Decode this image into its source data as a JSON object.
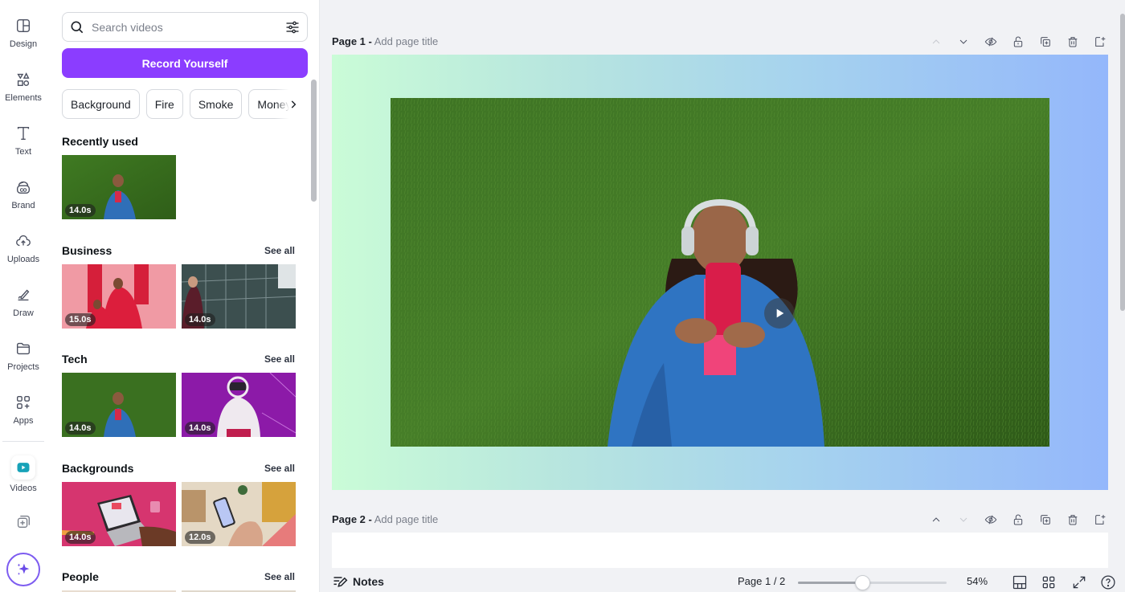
{
  "rail": {
    "items": [
      {
        "label": "Design",
        "icon": "layout-icon"
      },
      {
        "label": "Elements",
        "icon": "shapes-icon"
      },
      {
        "label": "Text",
        "icon": "text-icon"
      },
      {
        "label": "Brand",
        "icon": "brand-icon"
      },
      {
        "label": "Uploads",
        "icon": "cloud-upload-icon"
      },
      {
        "label": "Draw",
        "icon": "pen-icon"
      },
      {
        "label": "Projects",
        "icon": "folder-icon"
      },
      {
        "label": "Apps",
        "icon": "apps-icon"
      },
      {
        "label": "Videos",
        "icon": "video-icon"
      }
    ],
    "accent": "#17a2b8"
  },
  "panel": {
    "search_placeholder": "Search videos",
    "record_label": "Record Yourself",
    "record_color": "#8b3dff",
    "chips": [
      "Background",
      "Fire",
      "Smoke",
      "Money"
    ],
    "see_all": "See all",
    "sections": [
      {
        "title": "Recently used",
        "items": [
          {
            "duration": "14.0s",
            "subject": "woman on grass"
          }
        ]
      },
      {
        "title": "Business",
        "items": [
          {
            "duration": "15.0s",
            "subject": "women in red"
          },
          {
            "duration": "14.0s",
            "subject": "woman on phone by building"
          }
        ]
      },
      {
        "title": "Tech",
        "items": [
          {
            "duration": "14.0s",
            "subject": "woman on grass"
          },
          {
            "duration": "14.0s",
            "subject": "VR headset purple"
          }
        ]
      },
      {
        "title": "Backgrounds",
        "items": [
          {
            "duration": "14.0s",
            "subject": "laptop on pink"
          },
          {
            "duration": "12.0s",
            "subject": "phone in living room"
          }
        ]
      },
      {
        "title": "People",
        "items": []
      }
    ]
  },
  "canvas": {
    "page1": {
      "label": "Page 1 -",
      "title_placeholder": "Add page title"
    },
    "page2": {
      "label": "Page 2 -",
      "title_placeholder": "Add page title"
    },
    "tools": [
      "move-up",
      "move-down",
      "hide",
      "lock",
      "duplicate",
      "delete",
      "add-page"
    ]
  },
  "footer": {
    "notes": "Notes",
    "page_indicator": "Page 1 / 2",
    "zoom_label": "54%",
    "zoom_fraction": 0.43
  }
}
